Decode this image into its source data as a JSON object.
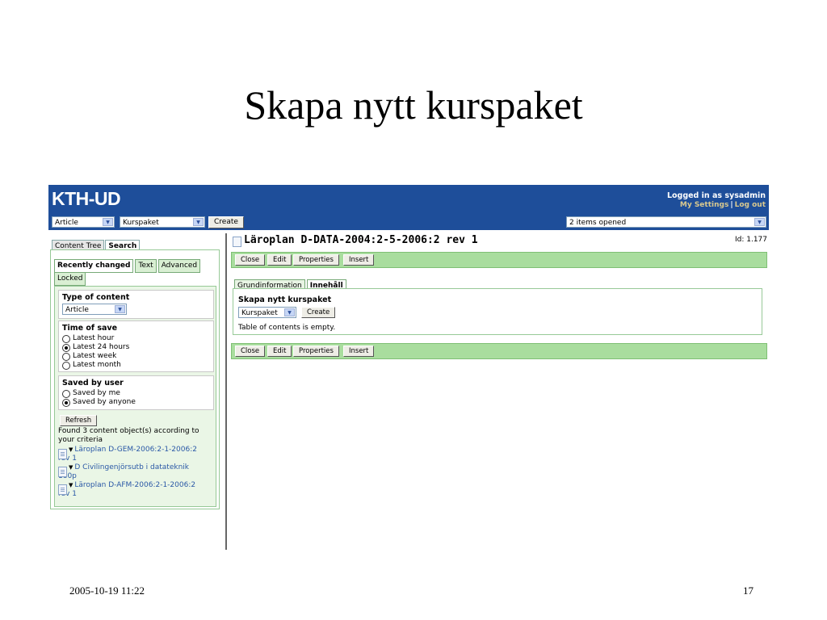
{
  "slide": {
    "title": "Skapa nytt kurspaket",
    "date": "2005-10-19 11:22",
    "page_number": "17"
  },
  "app": {
    "logo": "KTH-UD",
    "login_text": "Logged in as sysadmin",
    "my_settings": "My Settings",
    "separator": "|",
    "logout": "Log out",
    "type_select": "Article",
    "template_select": "Kurspaket",
    "create_label": "Create",
    "items_opened": "2 items opened"
  },
  "left": {
    "tabs": [
      "Content Tree",
      "Search"
    ],
    "subtabs": [
      "Recently changed",
      "Text",
      "Advanced"
    ],
    "locked_tab": "Locked",
    "type_of_content": {
      "title": "Type of content",
      "value": "Article"
    },
    "time_of_save": {
      "title": "Time of save",
      "options": [
        "Latest hour",
        "Latest 24 hours",
        "Latest week",
        "Latest month"
      ],
      "selected": "Latest 24 hours"
    },
    "saved_by_user": {
      "title": "Saved by user",
      "options": [
        "Saved by me",
        "Saved by anyone"
      ],
      "selected": "Saved by anyone"
    },
    "refresh_label": "Refresh",
    "results_text": "Found 3 content object(s) according to your criteria",
    "results": [
      {
        "line1": "Läroplan D-GEM-2006:2-1-2006:2",
        "line2": "rev 1"
      },
      {
        "line1": "D Civilingenjörsutb i datateknik",
        "line2": "180p"
      },
      {
        "line1": "Läroplan D-AFM-2006:2-1-2006:2",
        "line2": "rev 1"
      }
    ]
  },
  "document": {
    "title": "Läroplan D-DATA-2004:2-5-2006:2 rev 1",
    "id": "Id: 1.177",
    "toolbar": [
      "Close",
      "Edit",
      "Properties",
      "Insert"
    ],
    "tabs": [
      "Grundinformation",
      "Innehåll"
    ],
    "section_heading": "Skapa nytt kurspaket",
    "package_select": "Kurspaket",
    "create_label": "Create",
    "empty_text": "Table of contents is empty."
  },
  "icons": {
    "dropdown": "chevron-down-icon",
    "document": "document-icon",
    "radio": "radio-button",
    "caret": "caret-down-icon"
  },
  "colors": {
    "header_blue": "#1e4e9a",
    "toolbar_green": "#a9dd9e",
    "link_blue": "#2a58a6",
    "user_links": "#d9c98f"
  }
}
